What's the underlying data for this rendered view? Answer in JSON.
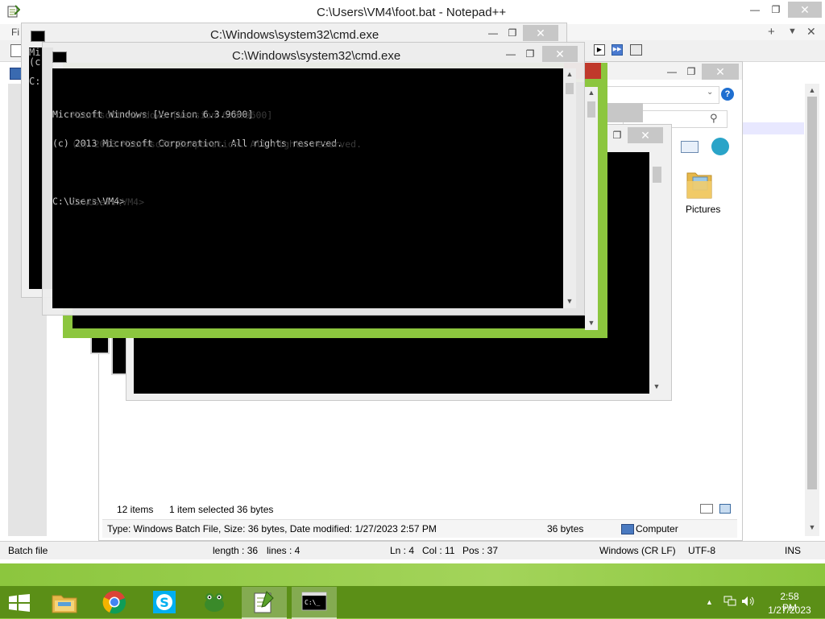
{
  "notepad": {
    "title": "C:\\Users\\VM4\\foot.bat - Notepad++",
    "menu_partial": "Fi",
    "status": {
      "type": "Batch file",
      "length": "length : 36",
      "lines": "lines : 4",
      "ln": "Ln : 4",
      "col": "Col : 11",
      "pos": "Pos : 37",
      "eol": "Windows (CR LF)",
      "encoding": "UTF-8",
      "mode": "INS"
    }
  },
  "cmd_back": {
    "title": "C:\\Windows\\system32\\cmd.exe",
    "lines": [
      "Mi",
      "(c",
      "",
      "C:"
    ]
  },
  "cmd_front": {
    "title": "C:\\Windows\\system32\\cmd.exe",
    "lines": [
      "Microsoft Windows [Version 6.3.9600]",
      "(c) 2013 Microsoft Corporation. All rights reserved.",
      "",
      "C:\\Users\\VM4>"
    ],
    "ghost_lines": [
      "Microsoft Windows [Version 6.3.9600]",
      "(c) 2013 Microsoft Corporation. All rights reserved.",
      "",
      "C:\\Users\\VM4>"
    ]
  },
  "explorer": {
    "folder_label": "Pictures",
    "item_count": "12 items",
    "selection": "1 item selected  36 bytes",
    "details": "Type: Windows Batch File, Size: 36 bytes, Date modified: 1/27/2023 2:57 PM",
    "size": "36 bytes",
    "location": "Computer"
  },
  "taskbar": {
    "time": "2:58 PM",
    "date": "1/27/2023",
    "apps": [
      "file-explorer",
      "chrome",
      "skype",
      "frog-app",
      "notepad-plus-plus",
      "cmd"
    ]
  },
  "colors": {
    "desktop": "#8cc63e",
    "taskbar": "#54850f",
    "console_bg": "#000000",
    "console_fg": "#c0c0c0"
  }
}
